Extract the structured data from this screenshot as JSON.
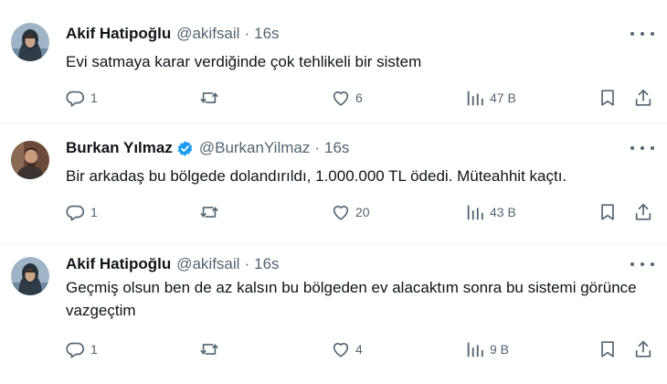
{
  "tweets": [
    {
      "name": "Akif Hatipoğlu",
      "handle": "@akifsail",
      "separator": "·",
      "time": "16s",
      "text": "Evi satmaya karar verdiğinde çok tehlikeli bir sistem",
      "verified": false,
      "avatar": "avatar-hooded-person",
      "replies": "1",
      "retweets": "",
      "likes": "6",
      "views": "47 B"
    },
    {
      "name": "Burkan Yılmaz",
      "handle": "@BurkanYilmaz",
      "separator": "·",
      "time": "16s",
      "text": "Bir arkadaş bu bölgede dolandırıldı, 1.000.000 TL ödedi. Müteahhit kaçtı.",
      "verified": true,
      "avatar": "avatar-man-bearded",
      "replies": "1",
      "retweets": "",
      "likes": "20",
      "views": "43 B"
    },
    {
      "name": "Akif Hatipoğlu",
      "handle": "@akifsail",
      "separator": "·",
      "time": "16s",
      "text": "Geçmiş olsun ben de az kalsın bu bölgeden ev alacaktım sonra bu sistemi görünce vazgeçtim",
      "verified": false,
      "avatar": "avatar-hooded-person",
      "replies": "1",
      "retweets": "",
      "likes": "4",
      "views": "9 B"
    }
  ],
  "icons": {
    "reply": "reply-icon",
    "retweet": "retweet-icon",
    "like": "heart-icon",
    "views": "views-icon",
    "bookmark": "bookmark-icon",
    "share": "share-icon",
    "more": "more-icon",
    "verified": "verified-badge-icon"
  },
  "colors": {
    "text": "#0f1419",
    "secondary": "#536471",
    "verified": "#1d9bf0",
    "divider": "#eff3f4"
  }
}
